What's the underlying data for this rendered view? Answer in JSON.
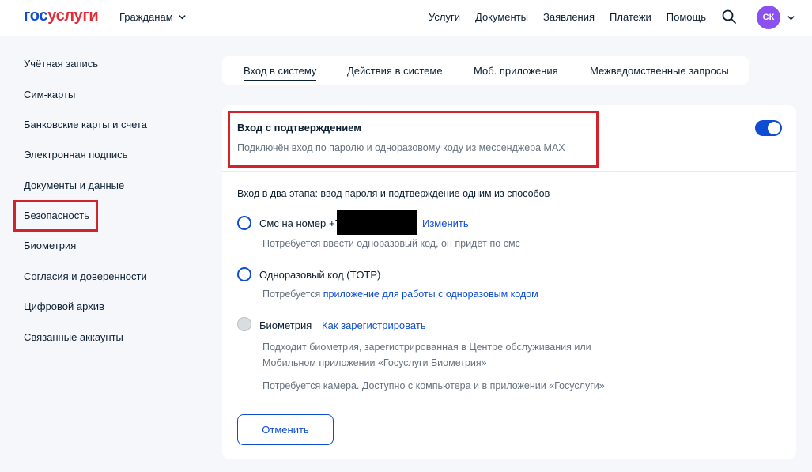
{
  "header": {
    "logo_part1": "гос",
    "logo_part2": "услуги",
    "audience_label": "Гражданам",
    "nav": [
      "Услуги",
      "Документы",
      "Заявления",
      "Платежи",
      "Помощь"
    ],
    "avatar_initials": "СК",
    "icons": [
      "search-icon",
      "chevron-down-icon"
    ]
  },
  "sidebar": {
    "items": [
      "Учётная запись",
      "Сим-карты",
      "Банковские карты и счета",
      "Электронная подпись",
      "Документы и данные",
      "Безопасность",
      "Биометрия",
      "Согласия и доверенности",
      "Цифровой архив",
      "Связанные аккаунты"
    ],
    "active_index": 5
  },
  "tabs": {
    "items": [
      "Вход в систему",
      "Действия в системе",
      "Моб. приложения",
      "Межведомственные запросы"
    ],
    "active_index": 0
  },
  "login_confirmation": {
    "title": "Вход с подтверждением",
    "description": "Подключён вход по паролю и одноразовому коду из мессенджера MAX",
    "toggle_on": true,
    "two_step_text": "Вход в два этапа: ввод пароля и подтверждение одним из способов",
    "options": {
      "sms": {
        "label": "Смс на номер",
        "phone_prefix": "+7",
        "change_link": "Изменить",
        "hint": "Потребуется ввести одноразовый код, он придёт по смс"
      },
      "totp": {
        "label": "Одноразовый код (TOTP)",
        "hint_prefix": "Потребуется",
        "hint_link": "приложение для работы с одноразовым кодом"
      },
      "biometry": {
        "label": "Биометрия",
        "register_link": "Как зарегистрировать",
        "hint_line1": "Подходит биометрия, зарегистрированная в Центре обслуживания или",
        "hint_line2": "Мобильном приложении «Госуслуги Биометрия»",
        "hint_line3": "Потребуется камера. Доступно с компьютера и в приложении «Госуслуги»"
      }
    },
    "cancel_button": "Отменить"
  },
  "colors": {
    "brand_blue": "#0d4cd3",
    "brand_red": "#e22c38",
    "highlight_red": "#d2232a",
    "avatar_purple": "#8c4ff0",
    "background": "#f5f7fa"
  }
}
